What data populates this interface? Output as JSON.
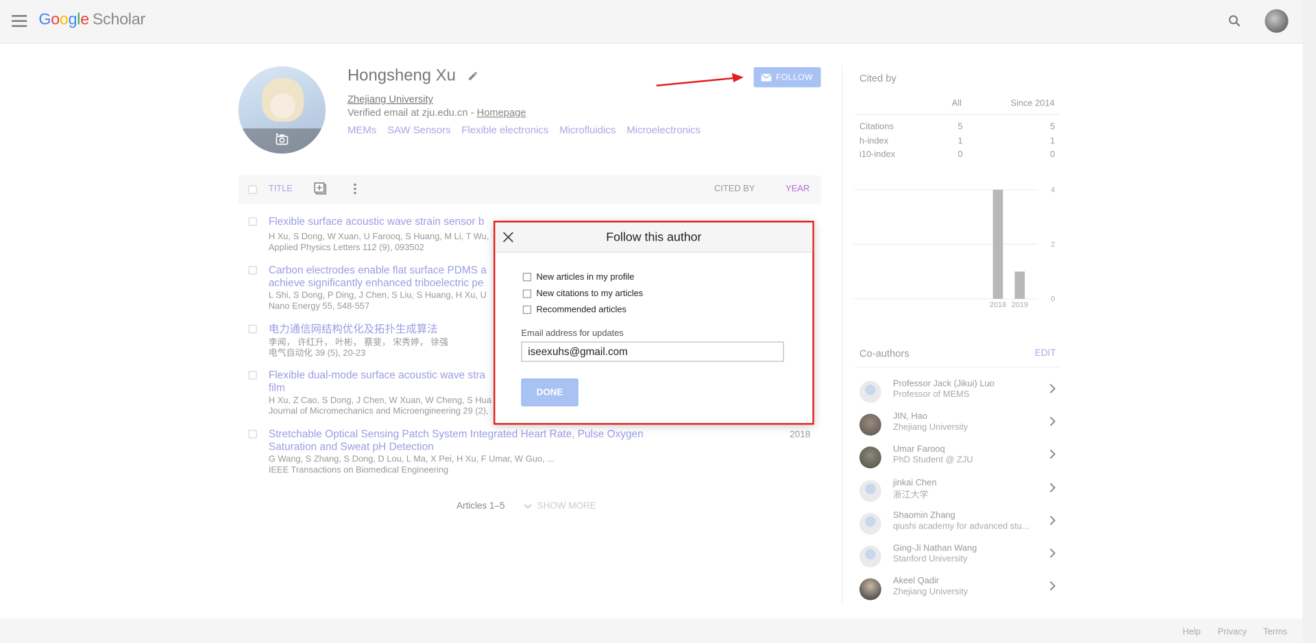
{
  "header": {
    "logo_google": "Google",
    "logo_scholar": "Scholar",
    "logo_colors": [
      "#4285F4",
      "#EA4335",
      "#FBBC05",
      "#4285F4",
      "#34A853",
      "#EA4335"
    ]
  },
  "profile": {
    "name": "Hongsheng Xu",
    "affiliation": "Zhejiang University",
    "verified_prefix": "Verified email at zju.edu.cn - ",
    "homepage": "Homepage",
    "interests": [
      "MEMs",
      "SAW Sensors",
      "Flexible electronics",
      "Microfluidics",
      "Microelectronics"
    ],
    "follow_label": "FOLLOW"
  },
  "table": {
    "title_header": "TITLE",
    "cited_header": "CITED BY",
    "year_header": "YEAR"
  },
  "articles": [
    {
      "title": "Flexible surface acoustic wave strain sensor b",
      "title2": "",
      "authors": "H Xu, S Dong, W Xuan, U Farooq, S Huang, M Li, T Wu,",
      "venue": "Applied Physics Letters 112 (9), 093502",
      "year": ""
    },
    {
      "title": "Carbon electrodes enable flat surface PDMS a",
      "title2": "achieve significantly enhanced triboelectric pe",
      "authors": "L Shi, S Dong, P Ding, J Chen, S Liu, S Huang, H Xu, U",
      "venue": "Nano Energy 55, 548-557",
      "year": ""
    },
    {
      "title": "电力通信网结构优化及拓扑生成算法",
      "title2": "",
      "authors": "李闻， 许红升， 叶彬， 蔡斐， 宋秀婷， 徐强",
      "venue": "电气自动化 39 (5), 20-23",
      "year": ""
    },
    {
      "title": "Flexible dual-mode surface acoustic wave stra",
      "title2": "film",
      "authors": "H Xu, Z Cao, S Dong, J Chen, W Xuan, W Cheng, S Hua",
      "venue": "Journal of Micromechanics and Microengineering 29 (2),",
      "year": ""
    },
    {
      "title": "Stretchable Optical Sensing Patch System Integrated Heart Rate, Pulse Oxygen",
      "title2": "Saturation and Sweat pH Detection",
      "authors": "G Wang, S Zhang, S Dong, D Lou, L Ma, X Pei, H Xu, F Umar, W Guo, ...",
      "venue": "IEEE Transactions on Biomedical Engineering",
      "year": "2018"
    }
  ],
  "pagination": {
    "articles_count": "Articles 1–5",
    "show_more": "SHOW MORE"
  },
  "cited_by": {
    "title": "Cited by",
    "col_all": "All",
    "col_since": "Since 2014",
    "rows": [
      {
        "label": "Citations",
        "all": "5",
        "since": "5"
      },
      {
        "label": "h-index",
        "all": "1",
        "since": "1"
      },
      {
        "label": "i10-index",
        "all": "0",
        "since": "0"
      }
    ]
  },
  "chart_data": {
    "type": "bar",
    "categories": [
      "2018",
      "2019"
    ],
    "values": [
      4,
      1
    ],
    "yticks": [
      "4",
      "2",
      "0"
    ],
    "ylim": [
      0,
      4
    ],
    "grid": true,
    "bar_color": "#b8b8b8"
  },
  "coauthors": {
    "title": "Co-authors",
    "edit": "EDIT",
    "list": [
      {
        "name": "Professor Jack (Jikui) Luo",
        "affil": "Professor of MEMS"
      },
      {
        "name": "JIN, Hao",
        "affil": "Zhejiang University"
      },
      {
        "name": "Umar Farooq",
        "affil": "PhD Student @ ZJU"
      },
      {
        "name": "jinkai Chen",
        "affil": "浙江大学"
      },
      {
        "name": "Shaomin Zhang",
        "affil": "qiushi academy for advanced stu..."
      },
      {
        "name": "Ging-Ji Nathan Wang",
        "affil": "Stanford University"
      },
      {
        "name": "Akeel Qadir",
        "affil": "Zhejiang University"
      }
    ]
  },
  "footer": {
    "help": "Help",
    "privacy": "Privacy",
    "terms": "Terms"
  },
  "modal": {
    "title": "Follow this author",
    "options": [
      "New articles in my profile",
      "New citations to my articles",
      "Recommended articles"
    ],
    "email_label": "Email address for updates",
    "email_value": "iseexuhs@gmail.com",
    "done": "DONE"
  },
  "colors": {
    "annotation_red": "#e41e1e",
    "link_purple": "#9c9ce6",
    "year_purple": "#b36bd6"
  }
}
